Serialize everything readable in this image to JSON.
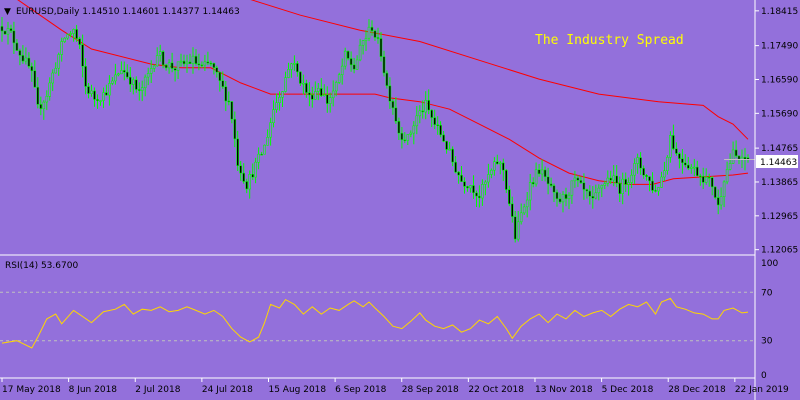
{
  "colors": {
    "background": "#9370DB",
    "candle": "#00FF00",
    "ma_fast": "#FF0000",
    "ma_slow": "#FF0000",
    "rsi_line": "#FFD700",
    "axis": "#FFFFFF",
    "text": "#000000",
    "watermark": "#FFFF00"
  },
  "header": {
    "menu_glyph": "▼",
    "title": "EURUSD,Daily  1.14510 1.14601 1.14377 1.14463"
  },
  "watermark": "The Industry Spread",
  "rsi_header": "RSI(14) 53.6700",
  "current_price_label": "1.14463",
  "chart_data": [
    {
      "type": "candlestick",
      "symbol": "EURUSD",
      "timeframe": "Daily",
      "ohlc_last": {
        "open": 1.1451,
        "high": 1.14601,
        "low": 1.14377,
        "close": 1.14463
      },
      "x_tick_labels": [
        "17 May 2018",
        "8 Jun 2018",
        "2 Jul 2018",
        "24 Jul 2018",
        "15 Aug 2018",
        "6 Sep 2018",
        "28 Sep 2018",
        "22 Oct 2018",
        "13 Nov 2018",
        "5 Dec 2018",
        "28 Dec 2018",
        "22 Jan 2019"
      ],
      "y_tick_labels": [
        "1.18415",
        "1.17490",
        "1.16590",
        "1.15690",
        "1.14765",
        "1.13865",
        "1.12965",
        "1.12065"
      ],
      "ylim": [
        1.1195,
        1.1865
      ],
      "close_points": [
        [
          0,
          1.18
        ],
        [
          3,
          1.178
        ],
        [
          6,
          1.173
        ],
        [
          9,
          1.169
        ],
        [
          10,
          1.167
        ],
        [
          12,
          1.158
        ],
        [
          15,
          1.162
        ],
        [
          18,
          1.17
        ],
        [
          21,
          1.177
        ],
        [
          24,
          1.179
        ],
        [
          26,
          1.174
        ],
        [
          28,
          1.164
        ],
        [
          31,
          1.161
        ],
        [
          34,
          1.162
        ],
        [
          37,
          1.165
        ],
        [
          40,
          1.169
        ],
        [
          43,
          1.166
        ],
        [
          46,
          1.162
        ],
        [
          49,
          1.167
        ],
        [
          52,
          1.173
        ],
        [
          55,
          1.17
        ],
        [
          58,
          1.169
        ],
        [
          61,
          1.17
        ],
        [
          64,
          1.171
        ],
        [
          67,
          1.169
        ],
        [
          70,
          1.17
        ],
        [
          73,
          1.165
        ],
        [
          76,
          1.16
        ],
        [
          77,
          1.156
        ],
        [
          79,
          1.144
        ],
        [
          82,
          1.138
        ],
        [
          85,
          1.143
        ],
        [
          88,
          1.148
        ],
        [
          91,
          1.158
        ],
        [
          94,
          1.164
        ],
        [
          97,
          1.171
        ],
        [
          100,
          1.166
        ],
        [
          103,
          1.161
        ],
        [
          106,
          1.164
        ],
        [
          109,
          1.16
        ],
        [
          112,
          1.164
        ],
        [
          115,
          1.172
        ],
        [
          118,
          1.169
        ],
        [
          121,
          1.176
        ],
        [
          124,
          1.18
        ],
        [
          127,
          1.173
        ],
        [
          129,
          1.164
        ],
        [
          131,
          1.159
        ],
        [
          133,
          1.152
        ],
        [
          136,
          1.15
        ],
        [
          139,
          1.156
        ],
        [
          142,
          1.159
        ],
        [
          145,
          1.154
        ],
        [
          148,
          1.15
        ],
        [
          151,
          1.144
        ],
        [
          154,
          1.139
        ],
        [
          157,
          1.138
        ],
        [
          160,
          1.135
        ],
        [
          163,
          1.14
        ],
        [
          166,
          1.144
        ],
        [
          168,
          1.142
        ],
        [
          170,
          1.133
        ],
        [
          172,
          1.124
        ],
        [
          174,
          1.13
        ],
        [
          177,
          1.138
        ],
        [
          180,
          1.142
        ],
        [
          183,
          1.138
        ],
        [
          186,
          1.133
        ],
        [
          189,
          1.135
        ],
        [
          192,
          1.139
        ],
        [
          195,
          1.136
        ],
        [
          198,
          1.133
        ],
        [
          201,
          1.138
        ],
        [
          204,
          1.14
        ],
        [
          207,
          1.137
        ],
        [
          210,
          1.14
        ],
        [
          213,
          1.144
        ],
        [
          216,
          1.14
        ],
        [
          219,
          1.136
        ],
        [
          222,
          1.142
        ],
        [
          224,
          1.151
        ],
        [
          226,
          1.146
        ],
        [
          229,
          1.144
        ],
        [
          232,
          1.142
        ],
        [
          235,
          1.14
        ],
        [
          238,
          1.138
        ],
        [
          240,
          1.132
        ],
        [
          242,
          1.14
        ],
        [
          245,
          1.146
        ],
        [
          248,
          1.144
        ],
        [
          250,
          1.1446
        ]
      ],
      "ma_fast_points": [
        [
          0,
          1.19
        ],
        [
          20,
          1.179
        ],
        [
          30,
          1.174
        ],
        [
          50,
          1.17
        ],
        [
          60,
          1.169
        ],
        [
          70,
          1.169
        ],
        [
          80,
          1.165
        ],
        [
          90,
          1.162
        ],
        [
          100,
          1.162
        ],
        [
          110,
          1.162
        ],
        [
          125,
          1.162
        ],
        [
          130,
          1.161
        ],
        [
          140,
          1.16
        ],
        [
          150,
          1.158
        ],
        [
          160,
          1.154
        ],
        [
          170,
          1.15
        ],
        [
          180,
          1.145
        ],
        [
          190,
          1.141
        ],
        [
          200,
          1.139
        ],
        [
          210,
          1.138
        ],
        [
          218,
          1.138
        ],
        [
          225,
          1.1395
        ],
        [
          235,
          1.14
        ],
        [
          245,
          1.1405
        ],
        [
          250,
          1.141
        ]
      ],
      "ma_slow_points": [
        [
          40,
          1.196
        ],
        [
          60,
          1.192
        ],
        [
          80,
          1.188
        ],
        [
          100,
          1.183
        ],
        [
          120,
          1.179
        ],
        [
          140,
          1.176
        ],
        [
          160,
          1.171
        ],
        [
          180,
          1.166
        ],
        [
          200,
          1.162
        ],
        [
          220,
          1.16
        ],
        [
          235,
          1.159
        ],
        [
          240,
          1.156
        ],
        [
          245,
          1.154
        ],
        [
          250,
          1.15
        ]
      ]
    },
    {
      "type": "line",
      "name": "RSI(14)",
      "last_value": 53.67,
      "ylim": [
        0,
        100
      ],
      "y_tick_labels": [
        "100",
        "70",
        "30",
        "0"
      ],
      "levels": [
        70,
        30
      ],
      "points": [
        [
          0,
          28
        ],
        [
          5,
          30
        ],
        [
          10,
          24
        ],
        [
          12,
          33
        ],
        [
          15,
          48
        ],
        [
          18,
          52
        ],
        [
          20,
          44
        ],
        [
          24,
          55
        ],
        [
          27,
          50
        ],
        [
          30,
          45
        ],
        [
          34,
          54
        ],
        [
          38,
          56
        ],
        [
          41,
          60
        ],
        [
          44,
          52
        ],
        [
          47,
          56
        ],
        [
          50,
          55
        ],
        [
          53,
          58
        ],
        [
          56,
          54
        ],
        [
          59,
          55
        ],
        [
          62,
          58
        ],
        [
          65,
          55
        ],
        [
          68,
          52
        ],
        [
          71,
          55
        ],
        [
          74,
          50
        ],
        [
          77,
          40
        ],
        [
          80,
          33
        ],
        [
          83,
          29
        ],
        [
          86,
          33
        ],
        [
          88,
          45
        ],
        [
          90,
          60
        ],
        [
          93,
          57
        ],
        [
          95,
          64
        ],
        [
          98,
          60
        ],
        [
          101,
          52
        ],
        [
          104,
          58
        ],
        [
          107,
          52
        ],
        [
          110,
          57
        ],
        [
          113,
          55
        ],
        [
          116,
          60
        ],
        [
          118,
          63
        ],
        [
          121,
          58
        ],
        [
          123,
          62
        ],
        [
          125,
          57
        ],
        [
          128,
          50
        ],
        [
          131,
          42
        ],
        [
          134,
          40
        ],
        [
          137,
          46
        ],
        [
          140,
          53
        ],
        [
          142,
          47
        ],
        [
          145,
          42
        ],
        [
          148,
          40
        ],
        [
          151,
          43
        ],
        [
          154,
          37
        ],
        [
          157,
          40
        ],
        [
          160,
          47
        ],
        [
          163,
          44
        ],
        [
          166,
          50
        ],
        [
          169,
          40
        ],
        [
          171,
          32
        ],
        [
          174,
          42
        ],
        [
          177,
          48
        ],
        [
          180,
          52
        ],
        [
          183,
          45
        ],
        [
          186,
          52
        ],
        [
          189,
          48
        ],
        [
          192,
          55
        ],
        [
          195,
          50
        ],
        [
          198,
          53
        ],
        [
          201,
          55
        ],
        [
          204,
          50
        ],
        [
          207,
          56
        ],
        [
          210,
          60
        ],
        [
          213,
          58
        ],
        [
          216,
          62
        ],
        [
          219,
          52
        ],
        [
          221,
          62
        ],
        [
          224,
          65
        ],
        [
          226,
          58
        ],
        [
          229,
          56
        ],
        [
          232,
          53
        ],
        [
          235,
          52
        ],
        [
          238,
          48
        ],
        [
          240,
          48
        ],
        [
          242,
          55
        ],
        [
          245,
          57
        ],
        [
          248,
          53
        ],
        [
          250,
          53.67
        ]
      ]
    }
  ]
}
